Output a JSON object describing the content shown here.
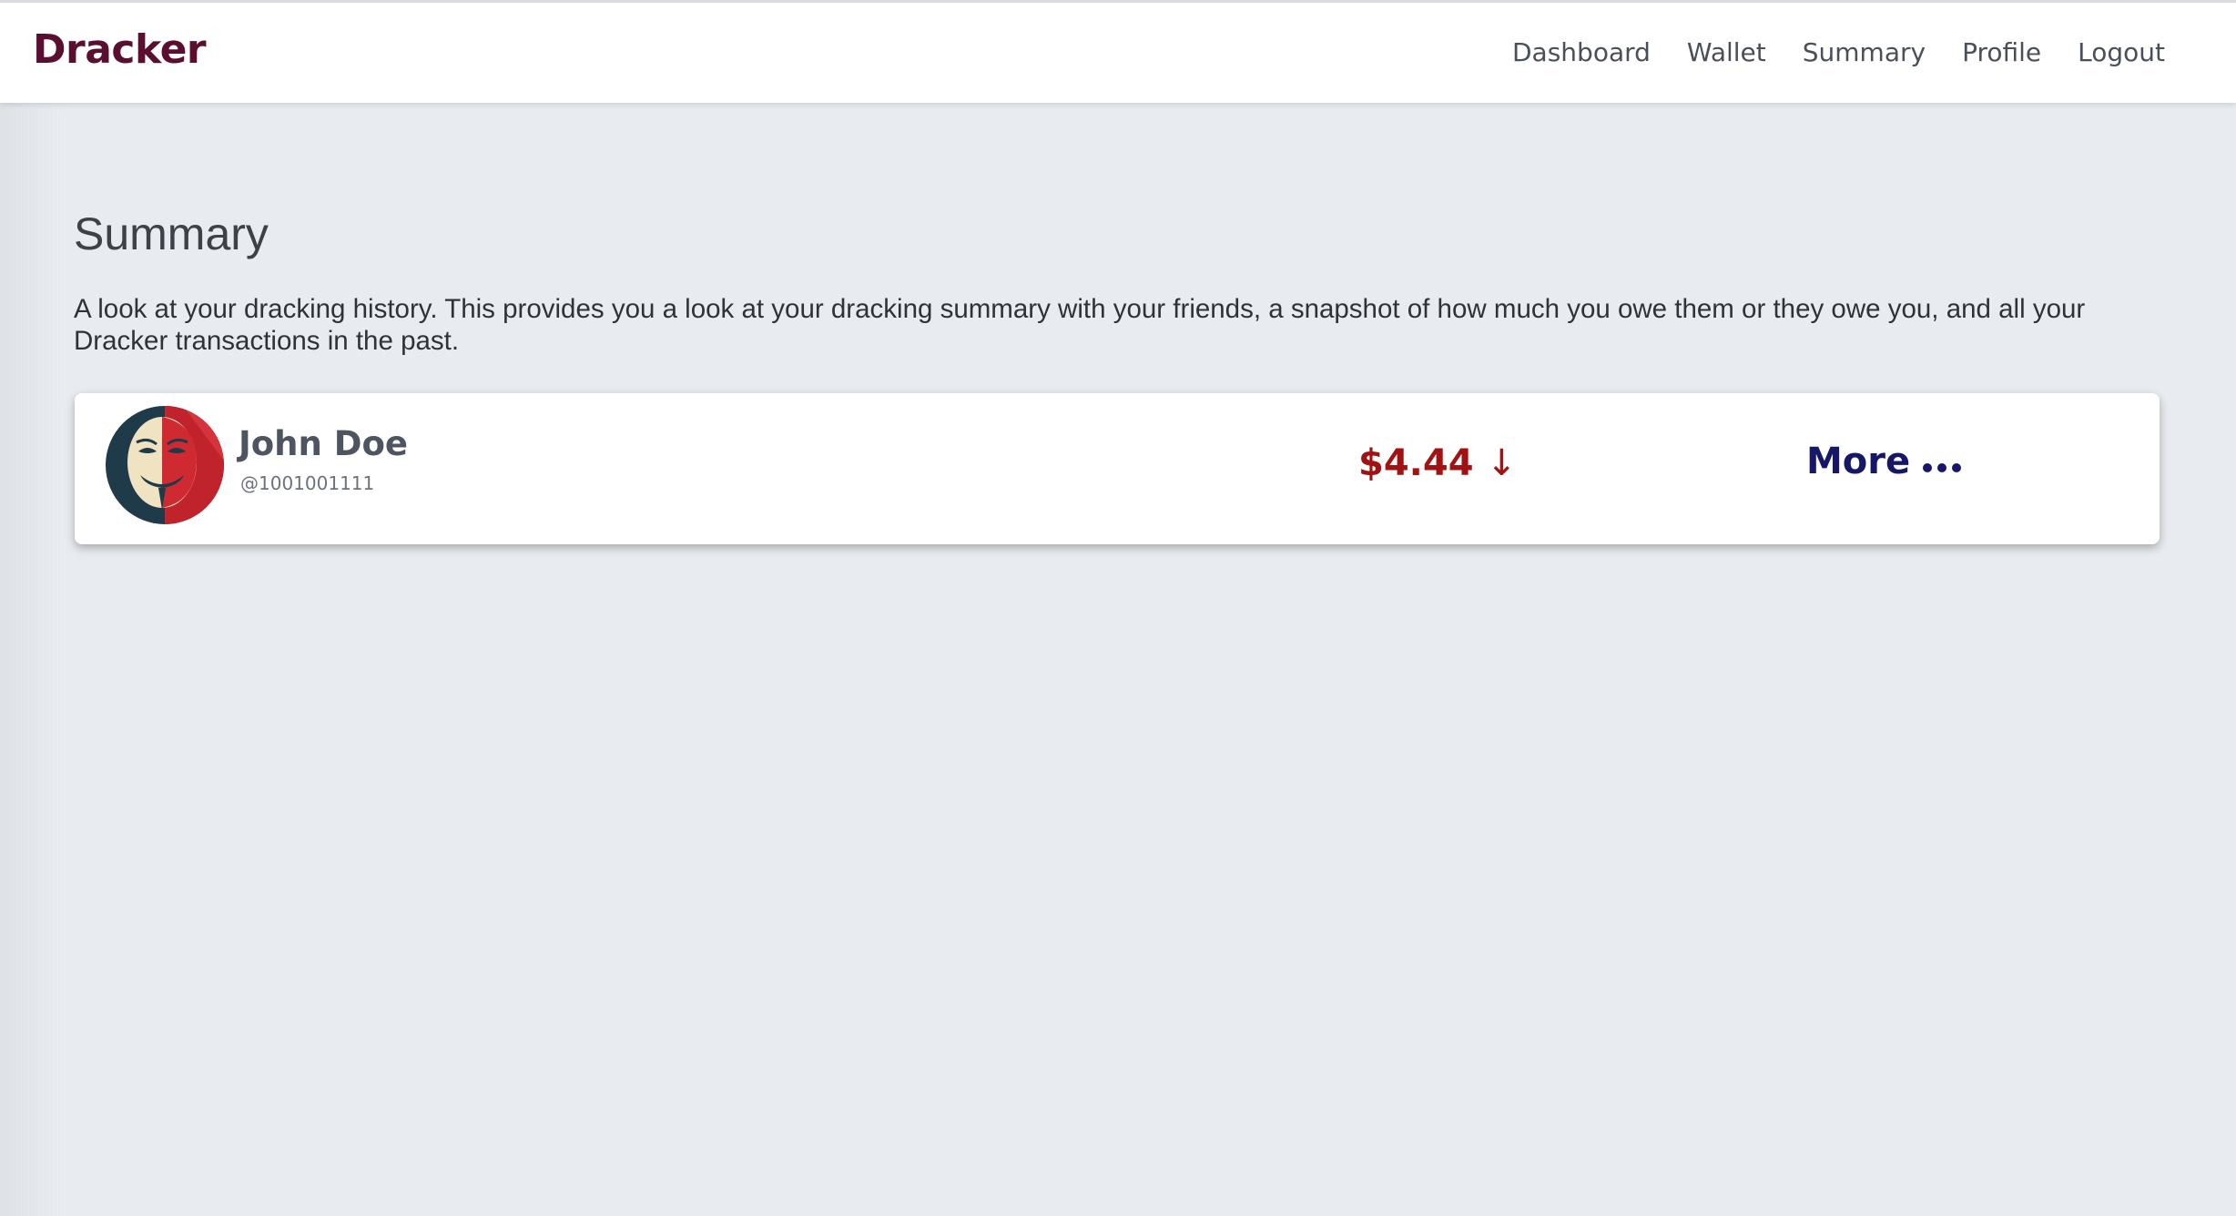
{
  "app": {
    "brand": "Dracker"
  },
  "nav": {
    "items": [
      {
        "label": "Dashboard"
      },
      {
        "label": "Wallet"
      },
      {
        "label": "Summary"
      },
      {
        "label": "Profile"
      },
      {
        "label": "Logout"
      }
    ]
  },
  "main": {
    "title": "Summary",
    "description": "A look at your dracking history. This provides you a look at your dracking summary with your friends, a snapshot of how much you owe them or they owe you, and all your Dracker transactions in the past."
  },
  "summary_cards": [
    {
      "name": "John Doe",
      "handle": "@1001001111",
      "amount": "$4.44",
      "direction_icon": "arrow-down-icon",
      "amount_color": "#a11212",
      "more_label": "More",
      "more_icon": "ellipsis-icon",
      "avatar_icon": "mask-avatar"
    }
  ],
  "colors": {
    "brand": "#5a0f30",
    "background": "#e8ebef",
    "more_link": "#161766"
  }
}
